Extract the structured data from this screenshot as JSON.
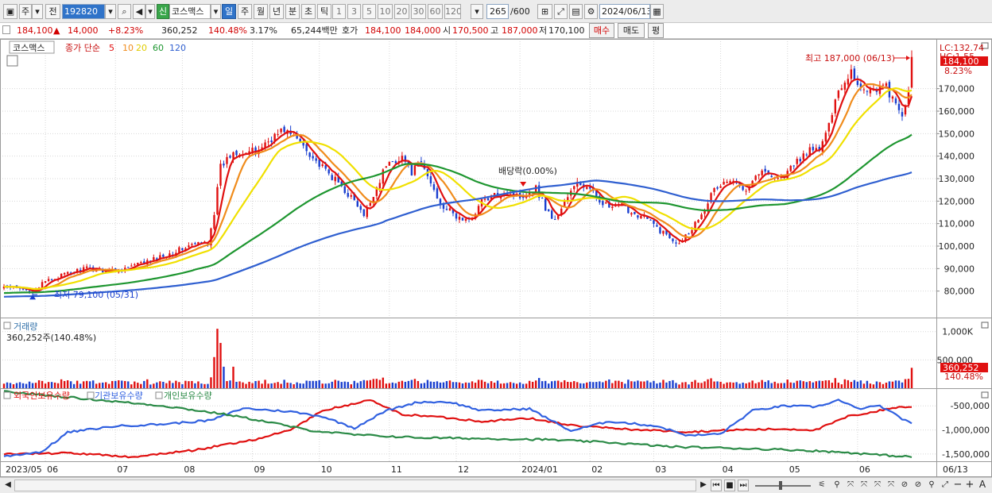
{
  "toolbar": {
    "market_btn": "주",
    "market_sel": "전",
    "code": "192820",
    "market_badge": "신",
    "name": "코스맥스",
    "period_buttons": [
      "일",
      "주",
      "월",
      "년",
      "분",
      "초",
      "틱"
    ],
    "active_period": "일",
    "number_buttons": [
      "1",
      "3",
      "5",
      "10",
      "20",
      "30",
      "60",
      "120"
    ],
    "count": "265",
    "count_total": "/600",
    "date": "2024/06/13"
  },
  "quote": {
    "price": "184,100",
    "change_arrow": "▲",
    "change": "14,000",
    "change_pct": "+8.23%",
    "volume": "360,252",
    "volume_pct": "140.48%",
    "turnover": "3.17%",
    "amount": "65,244백만",
    "ask_label": "호가",
    "ask1": "184,100",
    "ask2": "184,000",
    "open_label": "시",
    "open": "170,500",
    "high_label": "고",
    "high": "187,000",
    "low_label": "저",
    "low": "170,100",
    "buy_label": "매수",
    "sell_label": "매도",
    "eval_label": "평"
  },
  "legend": {
    "stock": "코스맥스",
    "ma_label": "종가 단순",
    "ma_periods": [
      {
        "label": "5",
        "color": "#e01010"
      },
      {
        "label": "10",
        "color": "#f08c1c"
      },
      {
        "label": "20",
        "color": "#f0e000"
      },
      {
        "label": "60",
        "color": "#1e9630"
      },
      {
        "label": "120",
        "color": "#2f5fd0"
      }
    ]
  },
  "annotations": {
    "high": "최고 187,000 (06/13)",
    "low": "최저 79,100 (05/31)",
    "dividend": "배당락(0.00%)",
    "lc": "LC:132.74",
    "hc": "HC:1.55",
    "last_price": "184,100",
    "last_pct": "8.23%"
  },
  "volume_panel": {
    "title": "거래량",
    "info": "360,252주(140.48%)",
    "last": "360,252",
    "last_pct": "140.48%"
  },
  "holdings_panel": {
    "legend": [
      "외국인보유수량",
      "기관보유수량",
      "개인보유수량"
    ],
    "colors": [
      "#e01010",
      "#3060e0",
      "#2a8a46"
    ]
  },
  "colors": {
    "up": "#e01010",
    "down": "#1a3fcf"
  },
  "chart_data": [
    {
      "type": "candlestick",
      "title": "코스맥스",
      "ylim": [
        70000,
        190000
      ],
      "y_ticks": [
        80000,
        90000,
        100000,
        110000,
        120000,
        130000,
        140000,
        150000,
        160000,
        170000
      ],
      "y_tick_labels": [
        "80,000",
        "90,000",
        "100,000",
        "110,000",
        "120,000",
        "130,000",
        "140,000",
        "150,000",
        "160,000",
        "170,000"
      ],
      "x_labels": [
        "2023/05",
        "06",
        "07",
        "08",
        "09",
        "10",
        "11",
        "12",
        "2024/01",
        "02",
        "03",
        "04",
        "05",
        "06",
        "06/13"
      ],
      "close_anchors": [
        [
          0,
          82000
        ],
        [
          6,
          80500
        ],
        [
          9,
          80000
        ],
        [
          14,
          85000
        ],
        [
          25,
          90000
        ],
        [
          35,
          89000
        ],
        [
          45,
          93000
        ],
        [
          58,
          100000
        ],
        [
          64,
          102000
        ],
        [
          66,
          115000
        ],
        [
          68,
          135000
        ],
        [
          72,
          142000
        ],
        [
          79,
          142000
        ],
        [
          84,
          148000
        ],
        [
          88,
          152000
        ],
        [
          94,
          145000
        ],
        [
          99,
          136000
        ],
        [
          105,
          128000
        ],
        [
          110,
          120000
        ],
        [
          113,
          113000
        ],
        [
          116,
          123000
        ],
        [
          120,
          136000
        ],
        [
          125,
          140000
        ],
        [
          128,
          133000
        ],
        [
          131,
          137000
        ],
        [
          134,
          128000
        ],
        [
          137,
          119000
        ],
        [
          142,
          113000
        ],
        [
          146,
          111000
        ],
        [
          150,
          120000
        ],
        [
          157,
          124000
        ],
        [
          162,
          122000
        ],
        [
          167,
          126000
        ],
        [
          170,
          117000
        ],
        [
          173,
          111000
        ],
        [
          176,
          120000
        ],
        [
          180,
          128000
        ],
        [
          183,
          126000
        ],
        [
          186,
          122000
        ],
        [
          190,
          117000
        ],
        [
          194,
          118000
        ],
        [
          197,
          115000
        ],
        [
          201,
          113000
        ],
        [
          206,
          107000
        ],
        [
          211,
          102000
        ],
        [
          213,
          103000
        ],
        [
          216,
          108000
        ],
        [
          219,
          115000
        ],
        [
          223,
          125000
        ],
        [
          227,
          129000
        ],
        [
          233,
          126000
        ],
        [
          237,
          133000
        ],
        [
          241,
          132000
        ],
        [
          244,
          130000
        ],
        [
          248,
          136000
        ],
        [
          252,
          142000
        ],
        [
          256,
          143000
        ],
        [
          259,
          153000
        ],
        [
          261,
          167000
        ],
        [
          263,
          171000
        ],
        [
          266,
          178000
        ],
        [
          269,
          170000
        ],
        [
          273,
          170000
        ],
        [
          277,
          171000
        ],
        [
          280,
          162000
        ],
        [
          282,
          157000
        ],
        [
          283,
          163000
        ],
        [
          284,
          170100
        ],
        [
          285,
          184100
        ]
      ],
      "last": {
        "open": 170500,
        "high": 187000,
        "low": 170100,
        "close": 184100
      },
      "moving_averages": [
        5,
        10,
        20,
        60,
        120
      ],
      "annotations": [
        {
          "text": "최고 187,000 (06/13)",
          "value": 187000
        },
        {
          "text": "최저 79,100 (05/31)",
          "value": 79100
        },
        {
          "text": "배당락(0.00%)"
        }
      ]
    },
    {
      "type": "bar",
      "title": "거래량",
      "ylim": [
        0,
        1150000
      ],
      "y_ticks": [
        500000,
        1000000
      ],
      "y_tick_labels": [
        "500,000",
        "1,000K"
      ],
      "last": 360252
    },
    {
      "type": "line",
      "series": [
        {
          "name": "외국인보유수량"
        },
        {
          "name": "기관보유수량"
        },
        {
          "name": "개인보유수량"
        }
      ],
      "ylim": [
        -1650000,
        -150000
      ],
      "y_ticks": [
        -500000,
        -1000000,
        -1500000
      ],
      "y_tick_labels": [
        "-500,000",
        "-1,000,000",
        "-1,500,000"
      ]
    }
  ],
  "nav": {
    "glyphs": [
      "▶",
      "⏮",
      "■",
      "⏭",
      "−",
      "+",
      "A"
    ]
  }
}
